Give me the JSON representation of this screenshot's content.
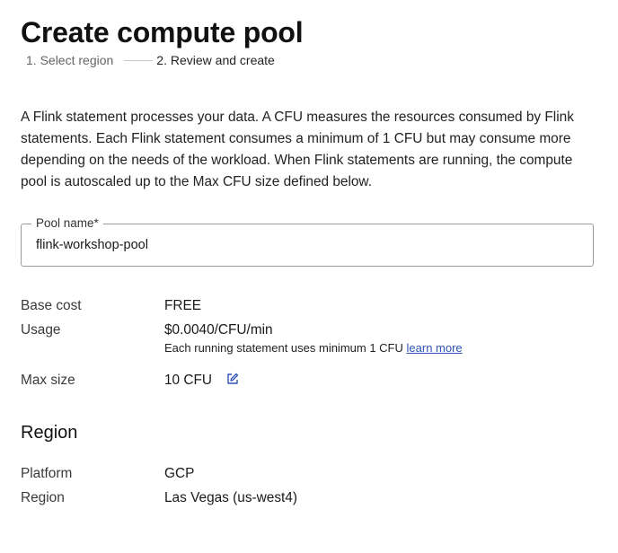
{
  "header": {
    "title": "Create compute pool"
  },
  "stepper": {
    "steps": [
      {
        "label": "1. Select region",
        "state": "inactive"
      },
      {
        "label": "2. Review and create",
        "state": "active"
      }
    ]
  },
  "description": "A Flink statement processes your data. A CFU measures the resources consumed by Flink statements. Each Flink statement consumes a minimum of 1 CFU but may consume more depending on the needs of the workload. When Flink statements are running, the compute pool is autoscaled up to the Max CFU size defined below.",
  "pool_name": {
    "label": "Pool name*",
    "value": "flink-workshop-pool"
  },
  "details": {
    "base_cost": {
      "label": "Base cost",
      "value": "FREE"
    },
    "usage": {
      "label": "Usage",
      "value": "$0.0040/CFU/min",
      "note": "Each running statement uses minimum 1 CFU",
      "link": "learn more"
    },
    "max_size": {
      "label": "Max size",
      "value": "10 CFU",
      "icon": "edit-icon"
    }
  },
  "region_section": {
    "heading": "Region",
    "platform": {
      "label": "Platform",
      "value": "GCP"
    },
    "region": {
      "label": "Region",
      "value": "Las Vegas (us-west4)"
    }
  },
  "colors": {
    "link": "#2f54b8",
    "border": "#9a9a9a",
    "text": "#1a1a1a",
    "muted": "#666666"
  }
}
